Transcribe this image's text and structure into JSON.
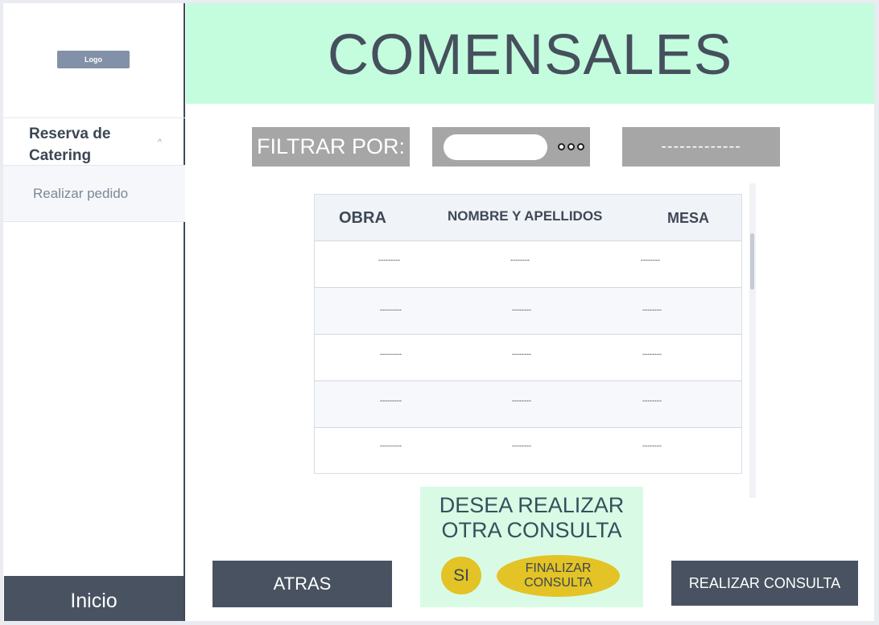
{
  "sidebar": {
    "logo": "Logo",
    "group_label": "Reserva de Catering",
    "chevron": "^",
    "submenu_label": "Realizar pedido",
    "home_label": "Inicio"
  },
  "header": {
    "title": "COMENSALES"
  },
  "filter": {
    "label": "FILTRAR POR:",
    "input_value": "",
    "select_value": "-------------"
  },
  "table": {
    "columns": [
      "OBRA",
      "NOMBRE Y APELLIDOS",
      "MESA"
    ],
    "rows": [
      [
        "---------",
        "--------",
        "--------"
      ],
      [
        "---------",
        "--------",
        "--------"
      ],
      [
        "---------",
        "--------",
        "--------"
      ],
      [
        "---------",
        "--------",
        "--------"
      ],
      [
        "---------",
        "--------",
        "--------"
      ]
    ]
  },
  "dialog": {
    "question_line1": "DESEA REALIZAR",
    "question_line2": "OTRA CONSULTA",
    "yes_label": "SI",
    "finish_line1": "FINALIZAR",
    "finish_line2": "CONSULTA"
  },
  "actions": {
    "back_label": "ATRAS",
    "query_label": "REALIZAR CONSULTA"
  },
  "colors": {
    "header_bg": "#c3fdde",
    "dark_button": "#485260",
    "filter_gray": "#a6a6a6",
    "accent_yellow": "#e3c325",
    "dialog_bg": "#d9fbe5"
  }
}
